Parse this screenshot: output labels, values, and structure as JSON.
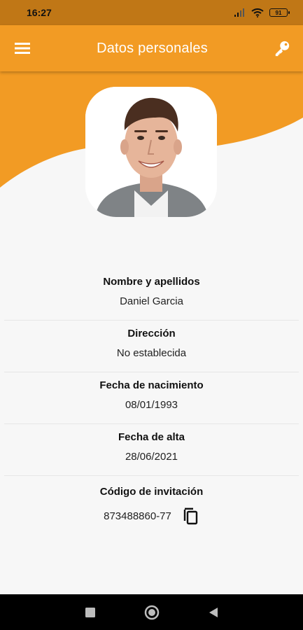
{
  "status_bar": {
    "time": "16:27",
    "battery": "91"
  },
  "app_bar": {
    "title": "Datos personales",
    "menu_icon": "menu-icon",
    "key_icon": "key-icon"
  },
  "colors": {
    "accent": "#f29b24",
    "status_bar": "#c07716",
    "background": "#f7f7f7"
  },
  "profile": {
    "fields": [
      {
        "label": "Nombre y apellidos",
        "value": "Daniel Garcia"
      },
      {
        "label": "Dirección",
        "value": "No establecida"
      },
      {
        "label": "Fecha de nacimiento",
        "value": "08/01/1993"
      },
      {
        "label": "Fecha de alta",
        "value": "28/06/2021"
      }
    ],
    "invitation": {
      "label": "Código de invitación",
      "code": "873488860-77",
      "copy_icon": "copy-icon"
    }
  },
  "nav_bar": {
    "recents_icon": "square-icon",
    "home_icon": "circle-icon",
    "back_icon": "triangle-back-icon"
  }
}
